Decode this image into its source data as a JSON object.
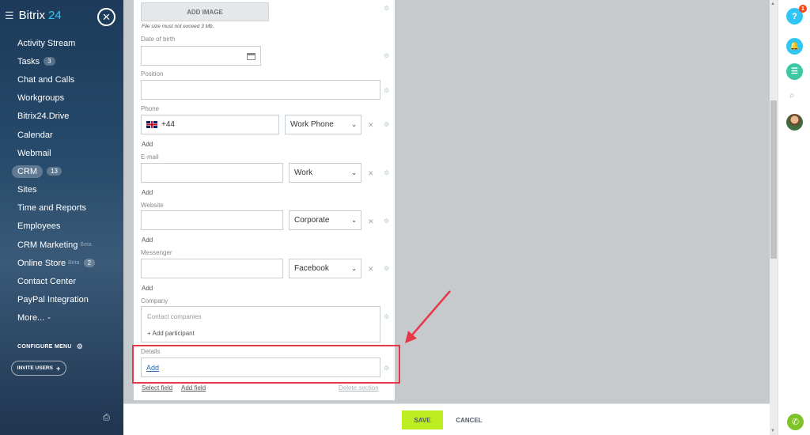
{
  "sidebar": {
    "brand_name": "Bitrix",
    "brand_num": "24",
    "menu": [
      {
        "label": "Activity Stream",
        "counter": ""
      },
      {
        "label": "Tasks",
        "counter": "3"
      },
      {
        "label": "Chat and Calls",
        "counter": ""
      },
      {
        "label": "Workgroups",
        "counter": ""
      },
      {
        "label": "Bitrix24.Drive",
        "counter": ""
      },
      {
        "label": "Calendar",
        "counter": ""
      },
      {
        "label": "Webmail",
        "counter": ""
      },
      {
        "label": "CRM",
        "counter": "13"
      },
      {
        "label": "Sites",
        "counter": ""
      },
      {
        "label": "Time and Reports",
        "counter": ""
      },
      {
        "label": "Employees",
        "counter": ""
      },
      {
        "label": "CRM Marketing",
        "counter": "",
        "soon": "Beta"
      },
      {
        "label": "Online Store",
        "counter": "2",
        "soon": "Beta"
      },
      {
        "label": "Contact Center",
        "counter": ""
      },
      {
        "label": "PayPal Integration",
        "counter": ""
      },
      {
        "label": "More...",
        "counter": ""
      }
    ],
    "configure_label": "CONFIGURE MENU",
    "invite_label": "INVITE USERS"
  },
  "form": {
    "add_image_label": "ADD IMAGE",
    "file_note": "File size must not exceed 3 Mb.",
    "dob_label": "Date of birth",
    "position_label": "Position",
    "phone_label": "Phone",
    "phone_value": "+44",
    "phone_type": "Work Phone",
    "email_label": "E-mail",
    "email_type": "Work",
    "website_label": "Website",
    "website_type": "Corporate",
    "messenger_label": "Messenger",
    "messenger_type": "Facebook",
    "add_label": "Add",
    "company_label": "Company",
    "company_placeholder": "Contact companies",
    "add_participant": "+ Add participant",
    "details_label": "Details",
    "details_add": "Add",
    "select_field": "Select field",
    "add_field": "Add field",
    "delete_section": "Delete section"
  },
  "footer": {
    "save_label": "SAVE",
    "cancel_label": "CANCEL"
  },
  "right_panel": {
    "help_badge": "1",
    "help_label": "?"
  },
  "colors": {
    "accent": "#2fc6f6",
    "save": "#bbed21",
    "highlight": "#e5394a",
    "link": "#2067b0"
  }
}
